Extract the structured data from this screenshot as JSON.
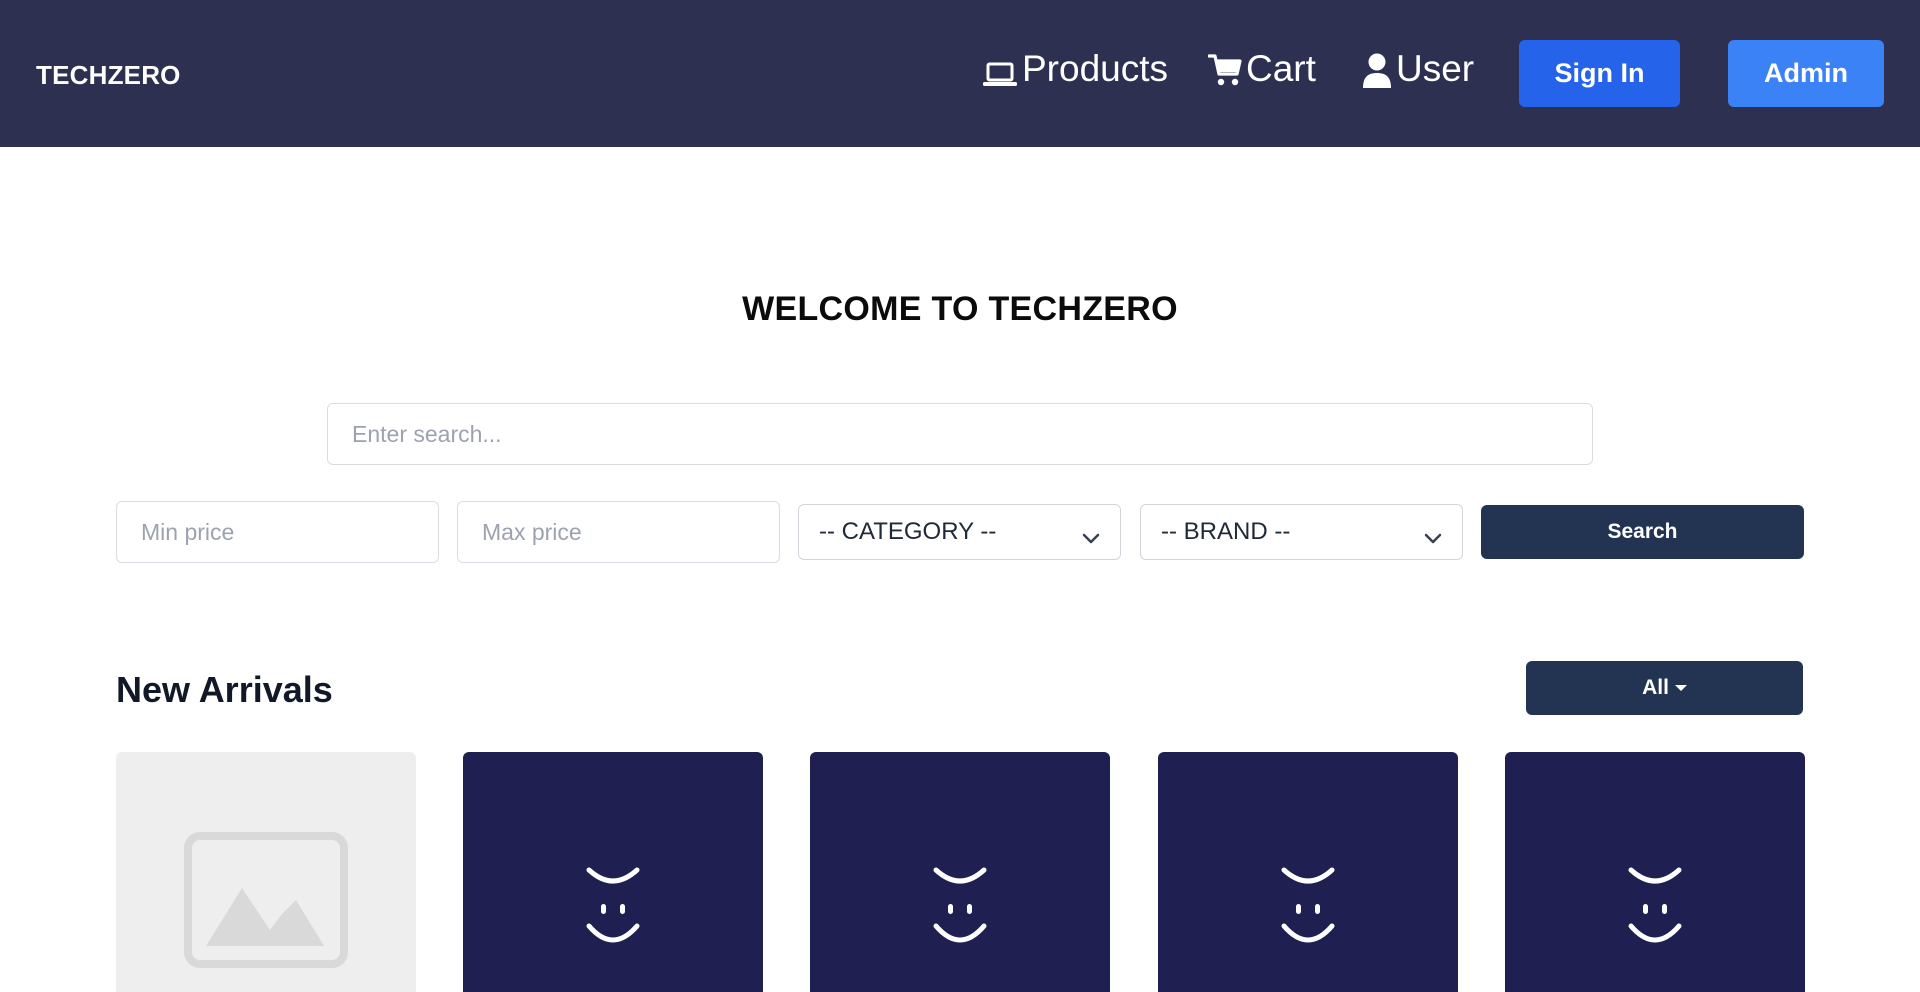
{
  "navbar": {
    "brand": "TECHZERO",
    "links": {
      "products": "Products",
      "cart": "Cart",
      "user": "User"
    },
    "signin_label": "Sign In",
    "admin_label": "Admin",
    "icons": [
      "laptop-icon",
      "cart-icon",
      "user-icon"
    ]
  },
  "hero": {
    "title": "WELCOME TO TECHZERO"
  },
  "search": {
    "placeholder": "Enter search...",
    "value": ""
  },
  "filters": {
    "min_price_placeholder": "Min price",
    "max_price_placeholder": "Max price",
    "category_selected": "-- CATEGORY --",
    "brand_selected": "-- BRAND --",
    "search_label": "Search"
  },
  "new_arrivals": {
    "title": "New Arrivals",
    "filter_label": "All",
    "products": [
      {
        "image": "image-placeholder-icon"
      },
      {
        "image": "smiley-logo-icon"
      },
      {
        "image": "smiley-logo-icon"
      },
      {
        "image": "smiley-logo-icon"
      },
      {
        "image": "smiley-logo-icon"
      }
    ]
  },
  "colors": {
    "navbar_bg": "#2d3051",
    "signin_bg": "#2563eb",
    "admin_bg": "#3b82f6",
    "primary_dark": "#233453",
    "card_dark": "#1f1f52",
    "placeholder_bg": "#eeeeee"
  }
}
